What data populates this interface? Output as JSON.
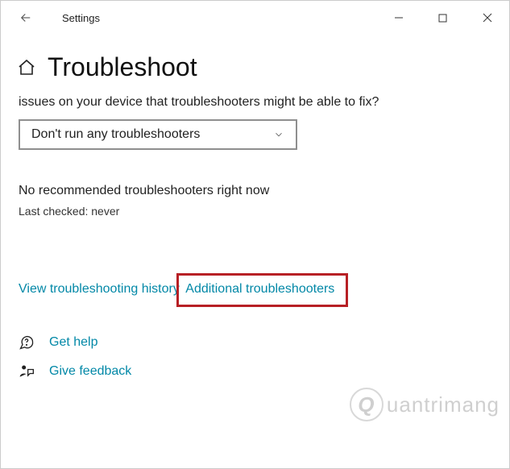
{
  "titlebar": {
    "app_title": "Settings"
  },
  "header": {
    "page_title": "Troubleshoot"
  },
  "content": {
    "partial_question": "issues on your device that troubleshooters might be able to fix?",
    "dropdown_selected": "Don't run any troubleshooters",
    "status_heading": "No recommended troubleshooters right now",
    "last_checked": "Last checked: never",
    "history_link": "View troubleshooting history",
    "additional_link": "Additional troubleshooters",
    "get_help": "Get help",
    "give_feedback": "Give feedback"
  },
  "watermark": {
    "circle": "Q",
    "text": "uantrimang"
  }
}
